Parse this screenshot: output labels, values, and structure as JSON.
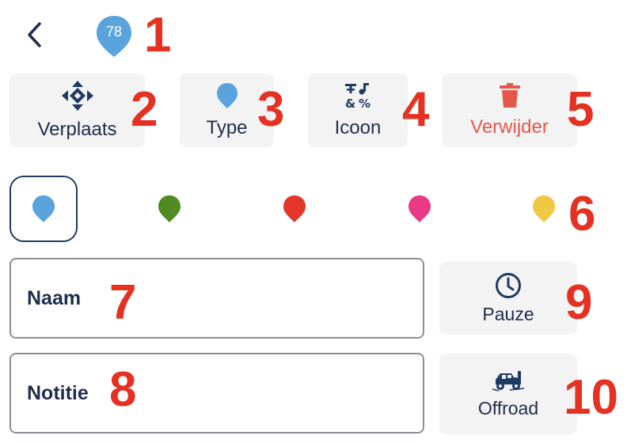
{
  "header": {
    "back_icon": "chevron-left-icon",
    "pin_number": "78",
    "pin_color": "#5aa3dc"
  },
  "toolbar": {
    "move_label": "Verplaats",
    "move_icon": "move-arrows-icon",
    "type_label": "Type",
    "type_icon": "pin-icon",
    "icon_label": "Icoon",
    "icon_icon": "symbols-icon",
    "delete_label": "Verwijder",
    "delete_icon": "trash-icon",
    "delete_color": "#e4584b"
  },
  "colors": {
    "options": [
      "#5aa3dc",
      "#4f8a22",
      "#e4372a",
      "#e83a86",
      "#f0c844"
    ],
    "selected_index": 0
  },
  "form": {
    "name_placeholder": "Naam",
    "note_placeholder": "Notitie"
  },
  "side": {
    "pause_label": "Pauze",
    "pause_icon": "clock-icon",
    "offroad_label": "Offroad",
    "offroad_icon": "offroad-vehicle-icon"
  },
  "callouts": [
    "1",
    "2",
    "3",
    "4",
    "5",
    "6",
    "7",
    "8",
    "9",
    "10"
  ]
}
